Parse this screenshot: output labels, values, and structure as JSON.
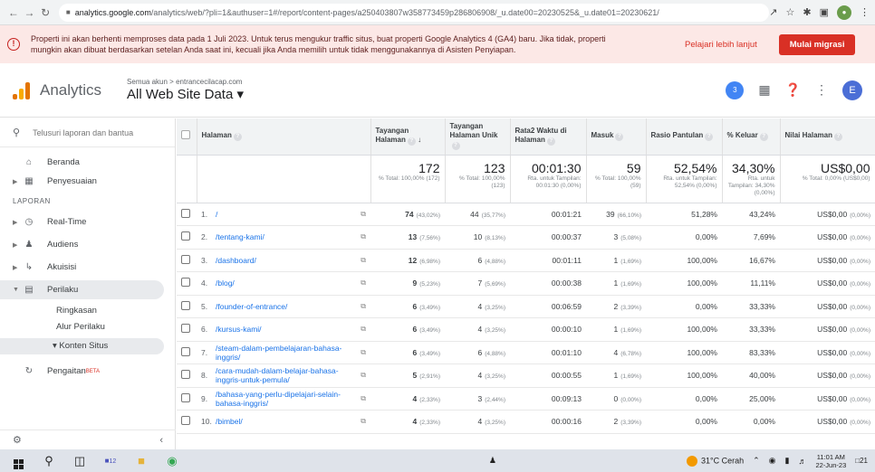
{
  "browser": {
    "url_host": "analytics.google.com",
    "url_path": "/analytics/web/?pli=1&authuser=1#/report/content-pages/a250403807w358773459p286806908/_u.date00=20230525&_u.date01=20230621/"
  },
  "banner": {
    "text": "Properti ini akan berhenti memproses data pada 1 Juli 2023. Untuk terus mengukur traffic situs, buat properti Google Analytics 4 (GA4) baru. Jika tidak, properti mungkin akan dibuat berdasarkan setelan Anda saat ini, kecuali jika Anda memilih untuk tidak menggunakannya di Asisten Penyiapan.",
    "link": "Pelajari lebih lanjut",
    "button": "Mulai migrasi"
  },
  "header": {
    "app_name": "Analytics",
    "breadcrumb": "Semua akun > entrancecilacap.com",
    "view": "All Web Site Data ▾",
    "notif_count": "3",
    "avatar": "E"
  },
  "sidebar": {
    "search_placeholder": "Telusuri laporan dan bantua",
    "home": "Beranda",
    "custom": "Penyesuaian",
    "section": "LAPORAN",
    "items": [
      {
        "label": "Real-Time"
      },
      {
        "label": "Audiens"
      },
      {
        "label": "Akuisisi"
      },
      {
        "label": "Perilaku"
      }
    ],
    "subitems": [
      "Ringkasan",
      "Alur Perilaku",
      "▾ Konten Situs"
    ],
    "attribution": "Pengaitan",
    "beta": "BETA"
  },
  "table": {
    "headers": {
      "page": "Halaman",
      "views": "Tayangan Halaman",
      "unique": "Tayangan Halaman Unik",
      "avgtime": "Rata2 Waktu di Halaman",
      "entrances": "Masuk",
      "bounce": "Rasio Pantulan",
      "exit": "% Keluar",
      "value": "Nilai Halaman"
    },
    "totals": {
      "views": "172",
      "views_sub": "% Total: 100,00% (172)",
      "unique": "123",
      "unique_sub": "% Total: 100,00% (123)",
      "avgtime": "00:01:30",
      "avgtime_sub": "Rta. untuk Tampilan: 00:01:30 (0,00%)",
      "entrances": "59",
      "entrances_sub": "% Total: 100,00% (59)",
      "bounce": "52,54%",
      "bounce_sub": "Rta. untuk Tampilan: 52,54% (0,00%)",
      "exit": "34,30%",
      "exit_sub": "Rta. untuk Tampilan: 34,30% (0,00%)",
      "value": "US$0,00",
      "value_sub": "% Total: 0,00% (US$0,00)"
    },
    "rows": [
      {
        "n": "1.",
        "page": "/",
        "views": "74",
        "views_pct": "(43,02%)",
        "unique": "44",
        "unique_pct": "(35,77%)",
        "avgtime": "00:01:21",
        "entr": "39",
        "entr_pct": "(66,10%)",
        "bounce": "51,28%",
        "exit": "43,24%",
        "value": "US$0,00",
        "value_pct": "(0,00%)"
      },
      {
        "n": "2.",
        "page": "/tentang-kami/",
        "views": "13",
        "views_pct": "(7,56%)",
        "unique": "10",
        "unique_pct": "(8,13%)",
        "avgtime": "00:00:37",
        "entr": "3",
        "entr_pct": "(5,08%)",
        "bounce": "0,00%",
        "exit": "7,69%",
        "value": "US$0,00",
        "value_pct": "(0,00%)"
      },
      {
        "n": "3.",
        "page": "/dashboard/",
        "views": "12",
        "views_pct": "(6,98%)",
        "unique": "6",
        "unique_pct": "(4,88%)",
        "avgtime": "00:01:11",
        "entr": "1",
        "entr_pct": "(1,69%)",
        "bounce": "100,00%",
        "exit": "16,67%",
        "value": "US$0,00",
        "value_pct": "(0,00%)"
      },
      {
        "n": "4.",
        "page": "/blog/",
        "views": "9",
        "views_pct": "(5,23%)",
        "unique": "7",
        "unique_pct": "(5,69%)",
        "avgtime": "00:00:38",
        "entr": "1",
        "entr_pct": "(1,69%)",
        "bounce": "100,00%",
        "exit": "11,11%",
        "value": "US$0,00",
        "value_pct": "(0,00%)"
      },
      {
        "n": "5.",
        "page": "/founder-of-entrance/",
        "views": "6",
        "views_pct": "(3,49%)",
        "unique": "4",
        "unique_pct": "(3,25%)",
        "avgtime": "00:06:59",
        "entr": "2",
        "entr_pct": "(3,39%)",
        "bounce": "0,00%",
        "exit": "33,33%",
        "value": "US$0,00",
        "value_pct": "(0,00%)"
      },
      {
        "n": "6.",
        "page": "/kursus-kami/",
        "views": "6",
        "views_pct": "(3,49%)",
        "unique": "4",
        "unique_pct": "(3,25%)",
        "avgtime": "00:00:10",
        "entr": "1",
        "entr_pct": "(1,69%)",
        "bounce": "100,00%",
        "exit": "33,33%",
        "value": "US$0,00",
        "value_pct": "(0,00%)"
      },
      {
        "n": "7.",
        "page": "/steam-dalam-pembelajaran-bahasa-inggris/",
        "views": "6",
        "views_pct": "(3,49%)",
        "unique": "6",
        "unique_pct": "(4,88%)",
        "avgtime": "00:01:10",
        "entr": "4",
        "entr_pct": "(6,78%)",
        "bounce": "100,00%",
        "exit": "83,33%",
        "value": "US$0,00",
        "value_pct": "(0,00%)"
      },
      {
        "n": "8.",
        "page": "/cara-mudah-dalam-belajar-bahasa-inggris-untuk-pemula/",
        "views": "5",
        "views_pct": "(2,91%)",
        "unique": "4",
        "unique_pct": "(3,25%)",
        "avgtime": "00:00:55",
        "entr": "1",
        "entr_pct": "(1,69%)",
        "bounce": "100,00%",
        "exit": "40,00%",
        "value": "US$0,00",
        "value_pct": "(0,00%)"
      },
      {
        "n": "9.",
        "page": "/bahasa-yang-perlu-dipelajari-selain-bahasa-inggris/",
        "views": "4",
        "views_pct": "(2,33%)",
        "unique": "3",
        "unique_pct": "(2,44%)",
        "avgtime": "00:09:13",
        "entr": "0",
        "entr_pct": "(0,00%)",
        "bounce": "0,00%",
        "exit": "25,00%",
        "value": "US$0,00",
        "value_pct": "(0,00%)"
      },
      {
        "n": "10.",
        "page": "/bimbel/",
        "views": "4",
        "views_pct": "(2,33%)",
        "unique": "4",
        "unique_pct": "(3,25%)",
        "avgtime": "00:00:16",
        "entr": "2",
        "entr_pct": "(3,39%)",
        "bounce": "0,00%",
        "exit": "0,00%",
        "value": "US$0,00",
        "value_pct": "(0,00%)"
      }
    ]
  },
  "taskbar": {
    "badge": "12",
    "weather": "31°C Cerah",
    "time": "11:01 AM",
    "date": "22-Jun-23",
    "notif": "21"
  },
  "colors": {
    "accent": "#d93025",
    "link": "#1a73e8",
    "ga_orange": "#e37400"
  }
}
